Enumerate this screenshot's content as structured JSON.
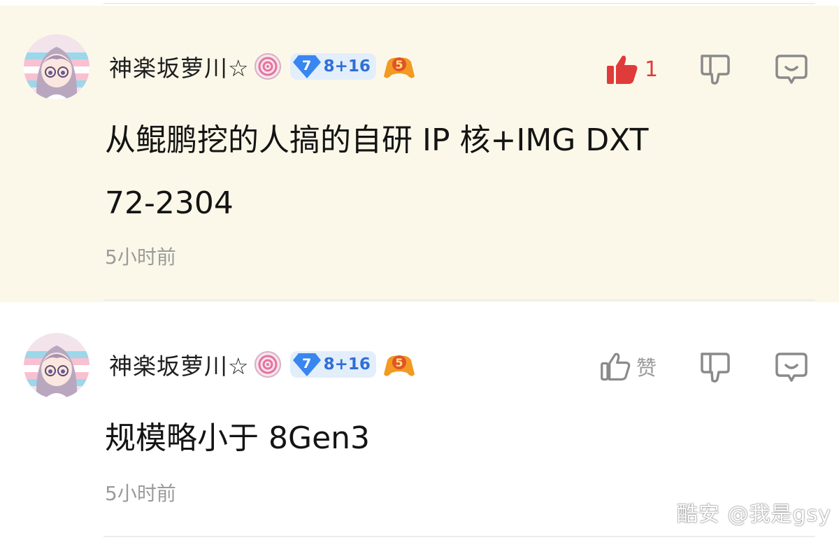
{
  "comments": [
    {
      "username": "神楽坂萝川☆",
      "level": "7",
      "level_text": "8+16",
      "badge_number": "5",
      "like_label": "1",
      "liked": true,
      "content_lines": [
        "从鲲鹏挖的人搞的自研 IP 核+IMG DXT",
        "72-2304"
      ],
      "time": "5小时前"
    },
    {
      "username": "神楽坂萝川☆",
      "level": "7",
      "level_text": "8+16",
      "badge_number": "5",
      "like_label": "赞",
      "liked": false,
      "content_lines": [
        "规模略小于 8Gen3"
      ],
      "time": "5小时前"
    }
  ],
  "icons": {
    "avatar": "anime-avatar-icon",
    "candy": "candy-swirl-icon",
    "level_gem": "diamond-level-icon",
    "gamepad": "gamepad-badge-icon",
    "like": "thumbs-up-icon",
    "dislike": "thumbs-down-icon",
    "reply": "reply-bubble-icon"
  },
  "colors": {
    "highlight_bg": "#fcf8e9",
    "liked_red": "#e03b3b",
    "level_blue": "#2f6fd6",
    "muted_gray": "#9b9b9b"
  },
  "watermark": "酷安 @我是gsy"
}
